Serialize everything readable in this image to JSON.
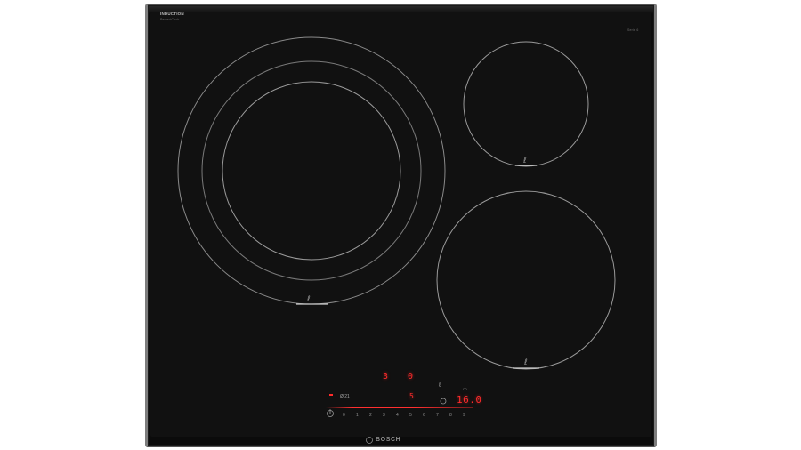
{
  "brand": {
    "logo_text": "BOSCH",
    "series_title": "INDUCTION",
    "series_subtitle": "PerfectCook",
    "model_tag": "Serie 6"
  },
  "display": {
    "power_level": "3",
    "power_zero": "0",
    "sub_digit": "5",
    "timer_value": "16.0",
    "top_left_label": "Ø 21",
    "slider_numbers": [
      "0",
      "1",
      "2",
      "3",
      "4",
      "5",
      "6",
      "7",
      "8",
      "9"
    ]
  },
  "colors": {
    "glass": "#111111",
    "frame": "#7d7d7d",
    "zone_line": "#8a8a8a",
    "display_red": "#ff2b2b"
  },
  "icons": [
    "power-icon",
    "pan-sensor-icon",
    "timer-icon",
    "lock-icon",
    "bosch-logo-icon"
  ]
}
